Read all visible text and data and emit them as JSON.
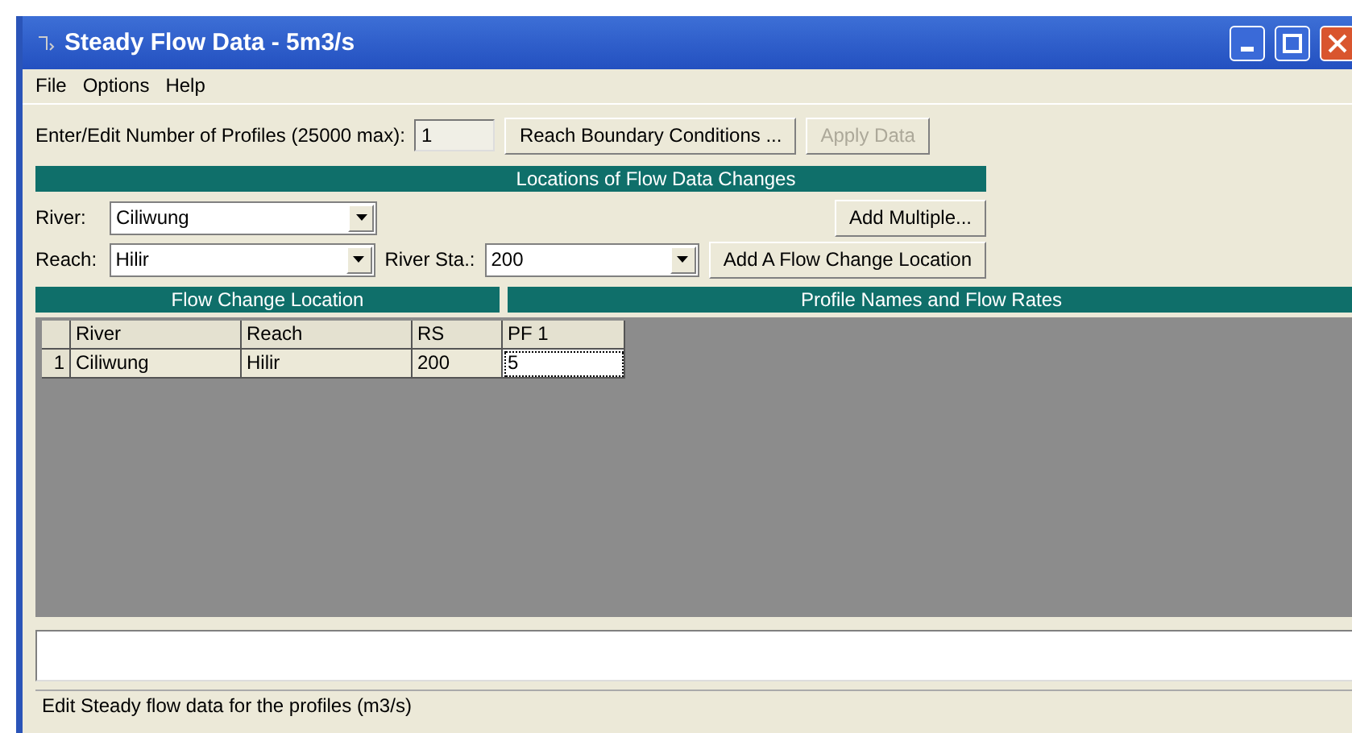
{
  "window": {
    "title": "Steady Flow Data - 5m3/s"
  },
  "menu": [
    "File",
    "Options",
    "Help"
  ],
  "profiles": {
    "label": "Enter/Edit Number of Profiles (25000 max):",
    "value": "1"
  },
  "top_buttons": [
    {
      "label": "Reach Boundary Conditions ...",
      "disabled": false
    },
    {
      "label": "Apply Data",
      "disabled": true
    }
  ],
  "locations_header": "Locations of Flow Data Changes",
  "river": {
    "label": "River:",
    "value": "Ciliwung"
  },
  "add_multiple": "Add Multiple...",
  "reach": {
    "label": "Reach:",
    "value": "Hilir"
  },
  "river_sta": {
    "label": "River Sta.:",
    "value": "200"
  },
  "add_location": "Add A Flow Change Location",
  "table": {
    "left_header": "Flow Change Location",
    "right_header": "Profile Names and Flow Rates",
    "columns": [
      "River",
      "Reach",
      "RS",
      "PF 1"
    ],
    "rows": [
      {
        "number": "1",
        "cells": [
          {
            "text": "Ciliwung",
            "selected": false
          },
          {
            "text": "Hilir",
            "selected": false
          },
          {
            "text": "200",
            "selected": false
          },
          {
            "text": "5",
            "selected": true
          }
        ]
      }
    ]
  },
  "status_bar": "Edit Steady flow data for the profiles (m3/s)"
}
